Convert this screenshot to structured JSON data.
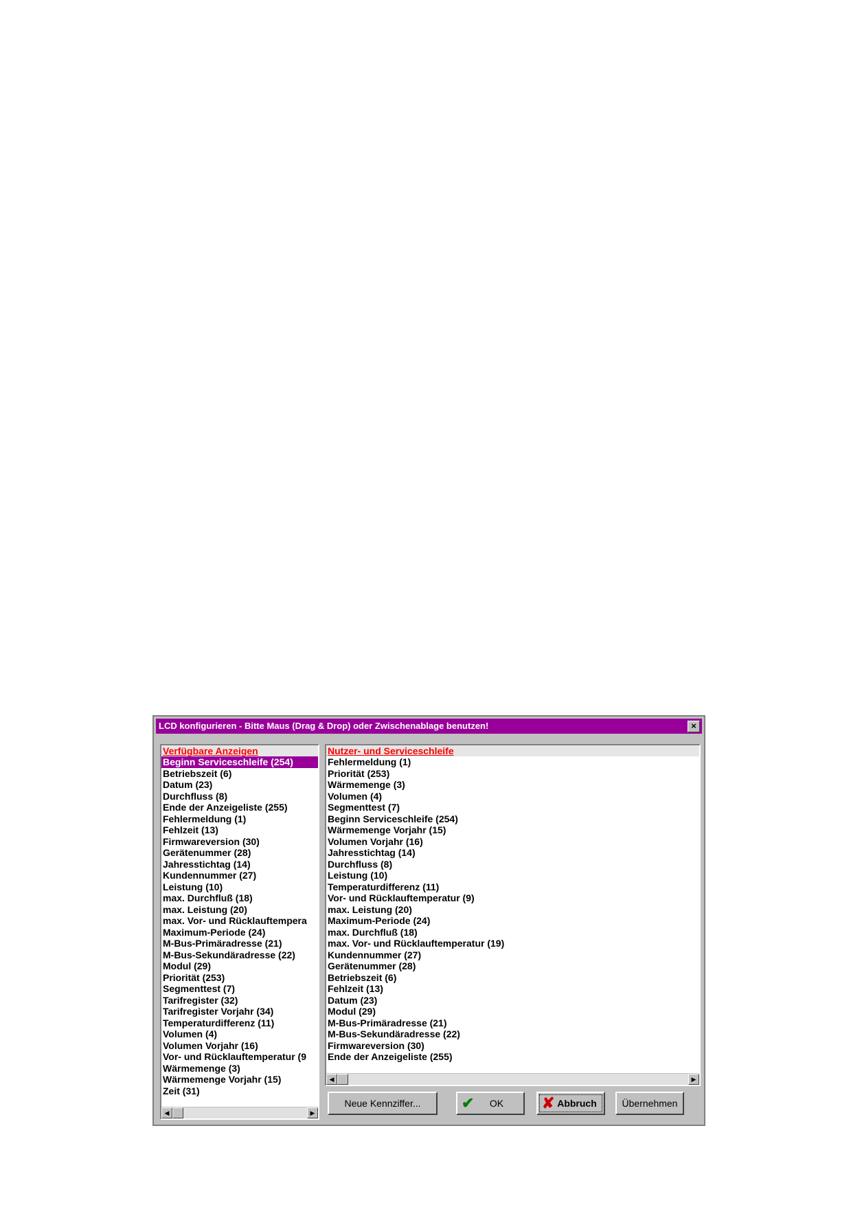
{
  "dialog": {
    "title": "LCD konfigurieren - Bitte Maus (Drag & Drop) oder Zwischenablage benutzen!",
    "close_label": "×",
    "left_list": {
      "header": "Verfügbare Anzeigen",
      "items": [
        "Beginn Serviceschleife (254)",
        "Betriebszeit (6)",
        "Datum (23)",
        "Durchfluss (8)",
        "Ende der Anzeigeliste (255)",
        "Fehlermeldung (1)",
        "Fehlzeit (13)",
        "Firmwareversion (30)",
        "Gerätenummer (28)",
        "Jahresstichtag (14)",
        "Kundennummer (27)",
        "Leistung (10)",
        "max. Durchfluß (18)",
        "max. Leistung (20)",
        "max. Vor- und Rücklauftempera",
        "Maximum-Periode (24)",
        "M-Bus-Primäradresse (21)",
        "M-Bus-Sekundäradresse (22)",
        "Modul (29)",
        "Priorität (253)",
        "Segmenttest (7)",
        "Tarifregister (32)",
        "Tarifregister Vorjahr (34)",
        "Temperaturdifferenz (11)",
        "Volumen (4)",
        "Volumen Vorjahr (16)",
        "Vor- und Rücklauftemperatur (9",
        "Wärmemenge (3)",
        "Wärmemenge Vorjahr (15)",
        "Zeit (31)"
      ],
      "selected_index": 0
    },
    "right_list": {
      "header": "Nutzer- und Serviceschleife",
      "items": [
        "Fehlermeldung (1)",
        "Priorität (253)",
        "Wärmemenge (3)",
        "Volumen (4)",
        "Segmenttest (7)",
        "Beginn Serviceschleife (254)",
        "Wärmemenge Vorjahr (15)",
        "Volumen Vorjahr (16)",
        "Jahresstichtag (14)",
        "Durchfluss (8)",
        "Leistung (10)",
        "Temperaturdifferenz (11)",
        "Vor- und Rücklauftemperatur (9)",
        "max. Leistung (20)",
        "Maximum-Periode (24)",
        "max. Durchfluß (18)",
        "max. Vor- und Rücklauftemperatur (19)",
        "Kundennummer (27)",
        "Gerätenummer (28)",
        "Betriebszeit (6)",
        "Fehlzeit (13)",
        "Datum (23)",
        "Modul (29)",
        "M-Bus-Primäradresse (21)",
        "M-Bus-Sekundäradresse (22)",
        "Firmwareversion (30)",
        "Ende der Anzeigeliste (255)"
      ]
    },
    "buttons": {
      "neue": "Neue Kennziffer...",
      "ok": "OK",
      "abbruch": "Abbruch",
      "uebernehmen": "Übernehmen"
    },
    "icons": {
      "ok_icon": "check-icon",
      "abbruch_icon": "x-icon",
      "ok_color": "#008000",
      "abbruch_color": "#cc0000"
    }
  }
}
